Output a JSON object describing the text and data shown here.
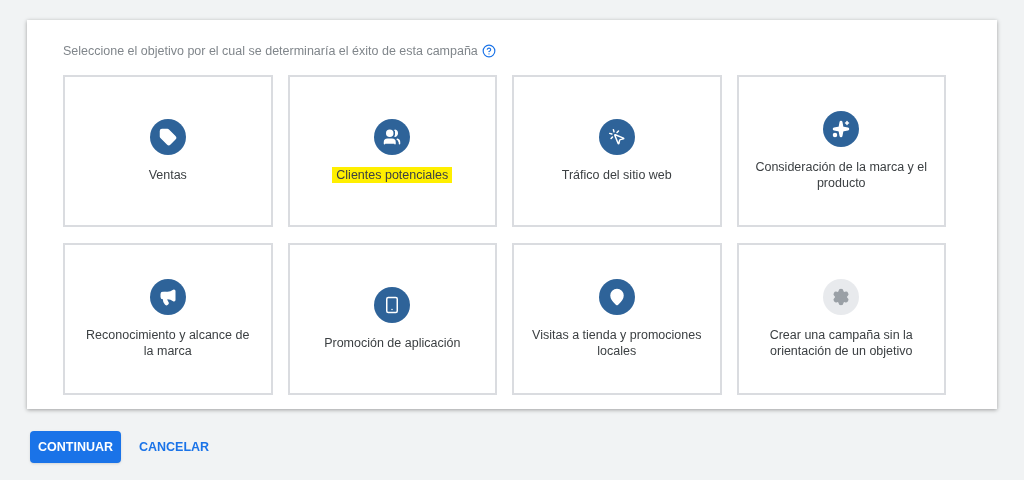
{
  "prompt": "Seleccione el objetivo por el cual se determinaría el éxito de esta campaña",
  "objectives": [
    {
      "label": "Ventas",
      "kind": "goal",
      "highlighted": false
    },
    {
      "label": "Clientes potenciales",
      "kind": "goal",
      "highlighted": true
    },
    {
      "label": "Tráfico del sitio web",
      "kind": "goal",
      "highlighted": false
    },
    {
      "label": "Consideración de la marca y el producto",
      "kind": "goal",
      "highlighted": false
    },
    {
      "label": "Reconocimiento y alcance de la marca",
      "kind": "goal",
      "highlighted": false
    },
    {
      "label": "Promoción de aplicación",
      "kind": "goal",
      "highlighted": false
    },
    {
      "label": "Visitas a tienda y promociones locales",
      "kind": "goal",
      "highlighted": false
    },
    {
      "label": "Crear una campaña sin la orientación de un objetivo",
      "kind": "no-goal",
      "highlighted": false
    }
  ],
  "buttons": [
    {
      "label": "CONTINUAR",
      "kind": "primary"
    },
    {
      "label": "CANCELAR",
      "kind": "text"
    }
  ]
}
